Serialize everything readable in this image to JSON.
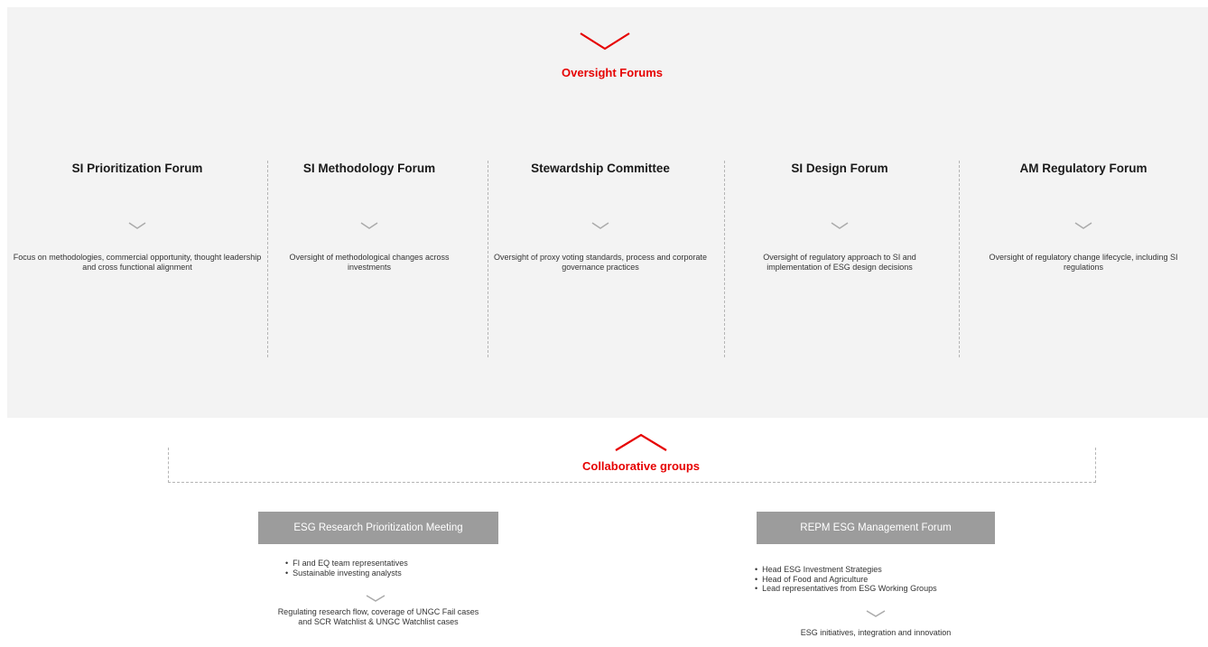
{
  "oversight": {
    "title": "Oversight Forums",
    "forums": [
      {
        "title": "SI Prioritization Forum",
        "description": "Focus on methodologies, commercial opportunity, thought leadership and cross functional alignment"
      },
      {
        "title": "SI Methodology Forum",
        "description": "Oversight of methodological changes across investments"
      },
      {
        "title": "Stewardship Committee",
        "description": "Oversight of proxy voting standards, process and corporate governance practices"
      },
      {
        "title": "SI Design Forum",
        "description": "Oversight of regulatory approach to SI and implementation of ESG design decisions"
      },
      {
        "title": "AM Regulatory Forum",
        "description": "Oversight of regulatory change lifecycle, including SI regulations"
      }
    ]
  },
  "collaborative": {
    "title": "Collaborative groups",
    "groups": [
      {
        "title": "ESG Research Prioritization Meeting",
        "bullets": [
          "FI and EQ team representatives",
          "Sustainable investing analysts"
        ],
        "description": "Regulating research flow, coverage of UNGC Fail cases and SCR Watchlist & UNGC Watchlist cases"
      },
      {
        "title": "REPM ESG Management Forum",
        "bullets": [
          "Head ESG Investment Strategies",
          "Head of Food and Agriculture",
          "Lead representatives from ESG Working Groups"
        ],
        "description": "ESG initiatives, integration and innovation"
      }
    ]
  },
  "colors": {
    "accent": "#e60000",
    "panel": "#f3f3f3",
    "group_box": "#9c9c9c"
  },
  "icons": [
    "chevron-down-icon",
    "chevron-up-icon"
  ]
}
